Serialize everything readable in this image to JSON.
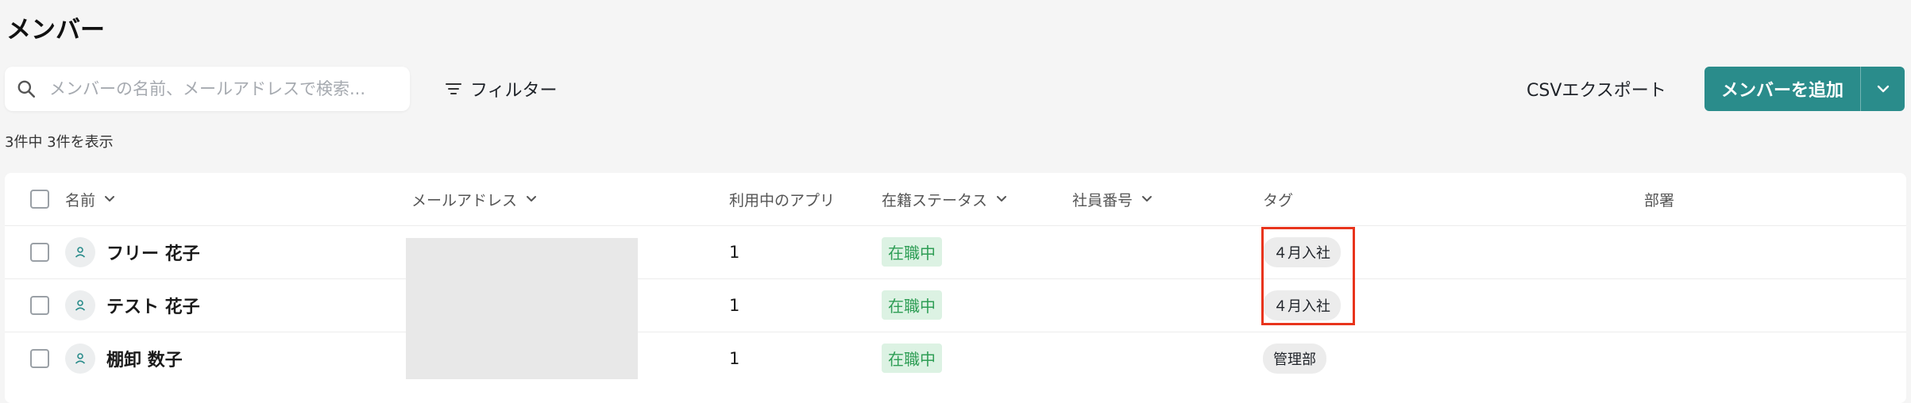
{
  "page": {
    "title": "メンバー"
  },
  "toolbar": {
    "search_placeholder": "メンバーの名前、メールアドレスで検索...",
    "filter_label": "フィルター",
    "csv_label": "CSVエクスポート",
    "add_label": "メンバーを追加",
    "result_count": "3件中 3件を表示"
  },
  "table": {
    "headers": {
      "name": "名前",
      "email": "メールアドレス",
      "apps": "利用中のアプリ",
      "status": "在籍ステータス",
      "employee_no": "社員番号",
      "tags": "タグ",
      "department": "部署"
    },
    "rows": [
      {
        "name": "フリー 花子",
        "apps": "1",
        "status": "在職中",
        "tag": "４月入社"
      },
      {
        "name": "テスト 花子",
        "apps": "1",
        "status": "在職中",
        "tag": "４月入社"
      },
      {
        "name": "棚卸 数子",
        "apps": "1",
        "status": "在職中",
        "tag": "管理部"
      }
    ]
  },
  "colors": {
    "accent": "#2a8c8b",
    "status_bg": "#dcf2e3",
    "status_text": "#2f9e56",
    "highlight": "#e8341c"
  },
  "icons": {
    "search": "search-icon",
    "filter": "filter-icon",
    "sort": "chevron-down-icon",
    "avatar": "person-icon",
    "dropdown": "chevron-down-icon"
  }
}
